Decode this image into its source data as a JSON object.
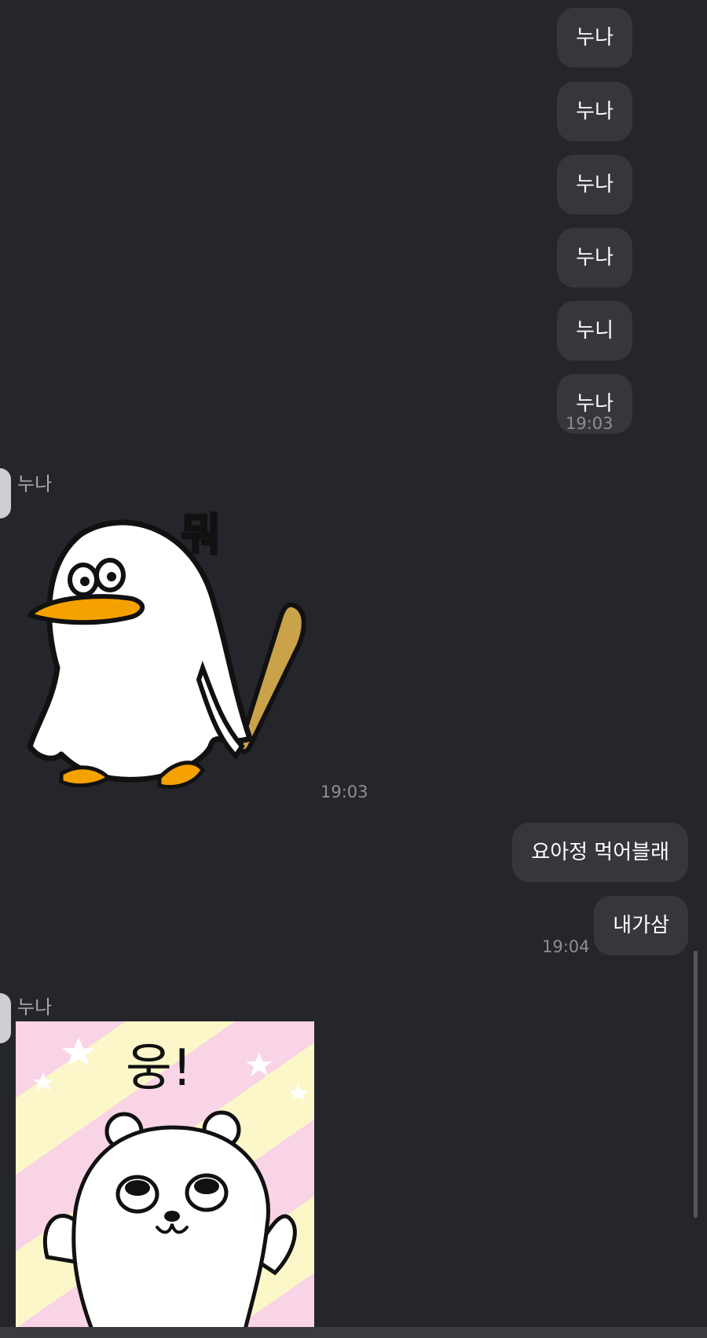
{
  "conversation": {
    "outgoing_group_1": {
      "messages": [
        "누나",
        "누나",
        "누나",
        "누나",
        "누니",
        "누나"
      ],
      "time": "19:03"
    },
    "incoming_1": {
      "sender": "누나",
      "sticker_text": "뭐",
      "sticker_desc_icon": "penguin-with-bat-sticker",
      "time": "19:03"
    },
    "outgoing_group_2": {
      "messages": [
        "요아정 먹어블래",
        "내가삼"
      ],
      "time": "19:04"
    },
    "incoming_2": {
      "sender": "누나",
      "sticker_text": "웅!",
      "sticker_desc_icon": "bear-waving-sticker"
    }
  },
  "colors": {
    "background": "#25262b",
    "bubble": "#36373c",
    "penguin_beak": "#f5a100",
    "bat": "#c9a24a",
    "sticker_pink": "#f9d3e6",
    "sticker_yellow": "#fbf7c8"
  }
}
